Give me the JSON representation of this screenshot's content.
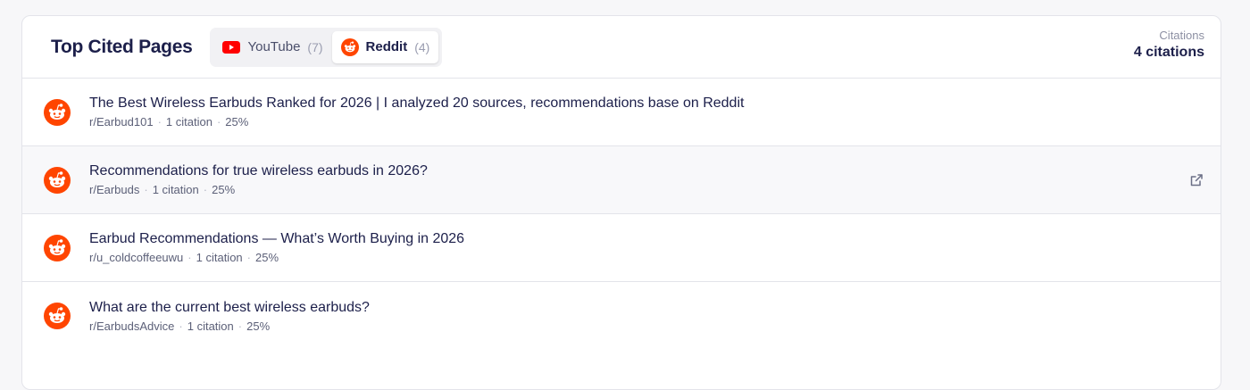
{
  "header": {
    "title": "Top Cited Pages",
    "summary_label": "Citations",
    "summary_value": "4 citations"
  },
  "tabs": [
    {
      "label": "YouTube",
      "count": "(7)",
      "icon": "youtube-icon",
      "active": false
    },
    {
      "label": "Reddit",
      "count": "(4)",
      "icon": "reddit-icon",
      "active": true
    }
  ],
  "rows": [
    {
      "title": "The Best Wireless Earbuds Ranked for 2026 | I analyzed 20 sources, recommendations base on Reddit",
      "subreddit": "r/Earbud101",
      "citations": "1 citation",
      "share": "25%"
    },
    {
      "title": "Recommendations for true wireless earbuds in 2026?",
      "subreddit": "r/Earbuds",
      "citations": "1 citation",
      "share": "25%"
    },
    {
      "title": "Earbud Recommendations — What’s Worth Buying in 2026",
      "subreddit": "r/u_coldcoffeeuwu",
      "citations": "1 citation",
      "share": "25%"
    },
    {
      "title": "What are the current best wireless earbuds?",
      "subreddit": "r/EarbudsAdvice",
      "citations": "1 citation",
      "share": "25%"
    }
  ],
  "colors": {
    "reddit": "#ff4500",
    "youtube": "#ff0000",
    "title": "#1c1f4a"
  }
}
